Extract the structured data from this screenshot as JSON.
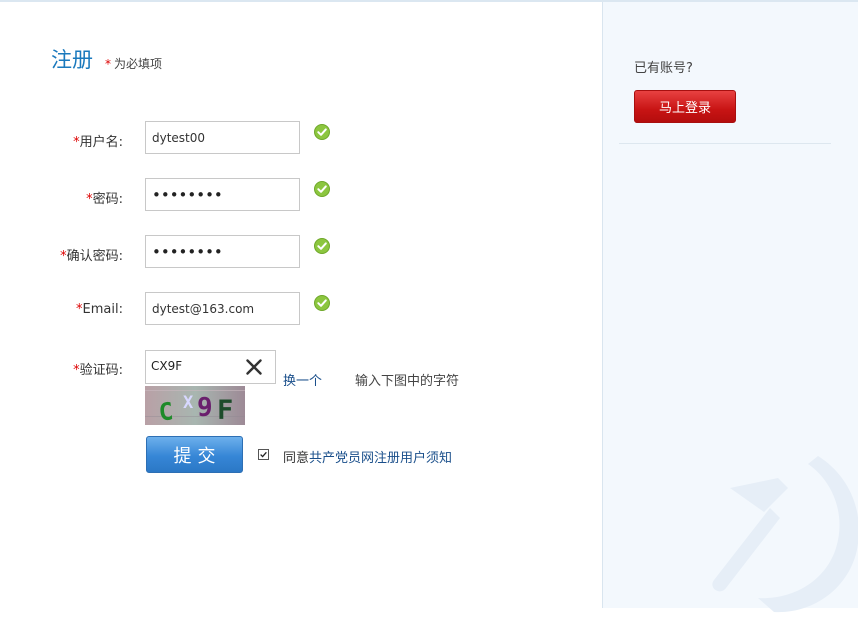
{
  "form": {
    "title": "注册",
    "required_star": "*",
    "required_note": "为必填项",
    "fields": [
      {
        "label": "用户名:",
        "value": "dytest00",
        "type": "text",
        "valid": true
      },
      {
        "label": "密码:",
        "value": "••••••••",
        "type": "password",
        "valid": true
      },
      {
        "label": "确认密码:",
        "value": "••••••••",
        "type": "password",
        "valid": true
      },
      {
        "label": "Email:",
        "value": "dytest@163.com",
        "type": "text",
        "valid": true
      }
    ],
    "captcha": {
      "label": "验证码:",
      "value": "CX9F",
      "refresh_label": "换一个",
      "hint": "输入下图中的字符",
      "image_text": "CX9F"
    },
    "submit_label": "提交",
    "agree": {
      "checked": true,
      "prefix": "同意",
      "link_text": "共产党员网注册用户须知"
    }
  },
  "sidebar": {
    "title": "已有账号?",
    "login_label": "马上登录"
  },
  "colors": {
    "title_blue": "#1a79bd",
    "required_red": "#dd0000",
    "submit_blue": "#3686d6",
    "login_red": "#c81414",
    "valid_green": "#8cc63f",
    "sidebar_bg": "#f3f8fd"
  }
}
